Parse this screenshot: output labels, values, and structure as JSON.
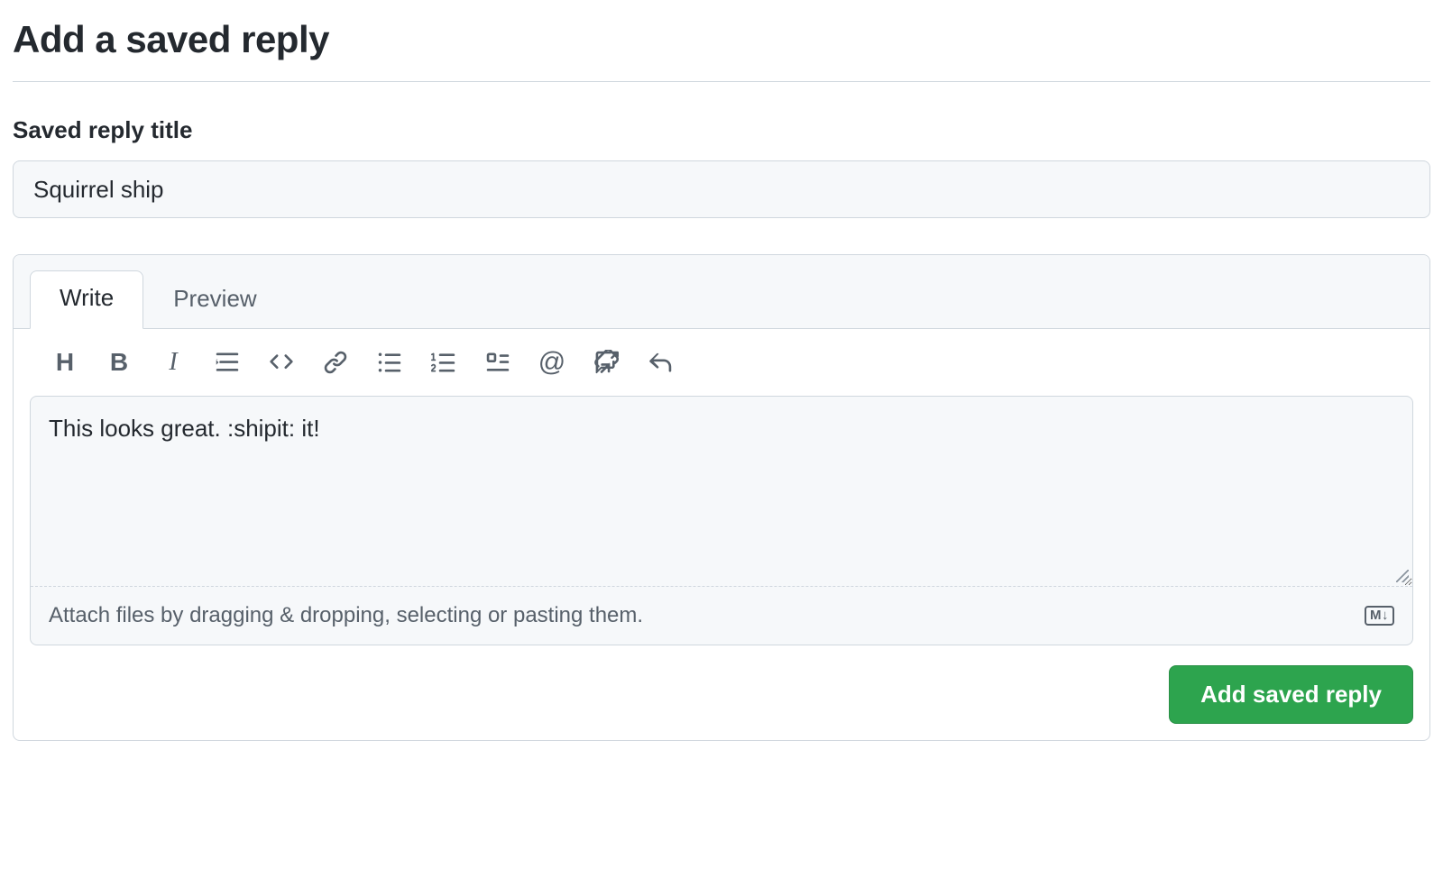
{
  "page": {
    "title": "Add a saved reply"
  },
  "form": {
    "title_label": "Saved reply title",
    "title_value": "Squirrel ship",
    "body_value": "This looks great. :shipit: it!",
    "attach_hint": "Attach files by dragging & dropping, selecting or pasting them.",
    "submit_label": "Add saved reply"
  },
  "tabs": {
    "write": "Write",
    "preview": "Preview",
    "active": "write"
  },
  "markdown_badge": "M↓",
  "toolbar": [
    {
      "name": "heading",
      "label": "H"
    },
    {
      "name": "bold",
      "label": "B"
    },
    {
      "name": "italic",
      "label": "I"
    },
    {
      "name": "quote",
      "label": "quote"
    },
    {
      "name": "code",
      "label": "code"
    },
    {
      "name": "link",
      "label": "link"
    },
    {
      "name": "unordered-list",
      "label": "ul"
    },
    {
      "name": "ordered-list",
      "label": "ol"
    },
    {
      "name": "task-list",
      "label": "tasks"
    },
    {
      "name": "mention",
      "label": "@"
    },
    {
      "name": "cross-reference",
      "label": "reference"
    },
    {
      "name": "reply",
      "label": "reply"
    }
  ]
}
